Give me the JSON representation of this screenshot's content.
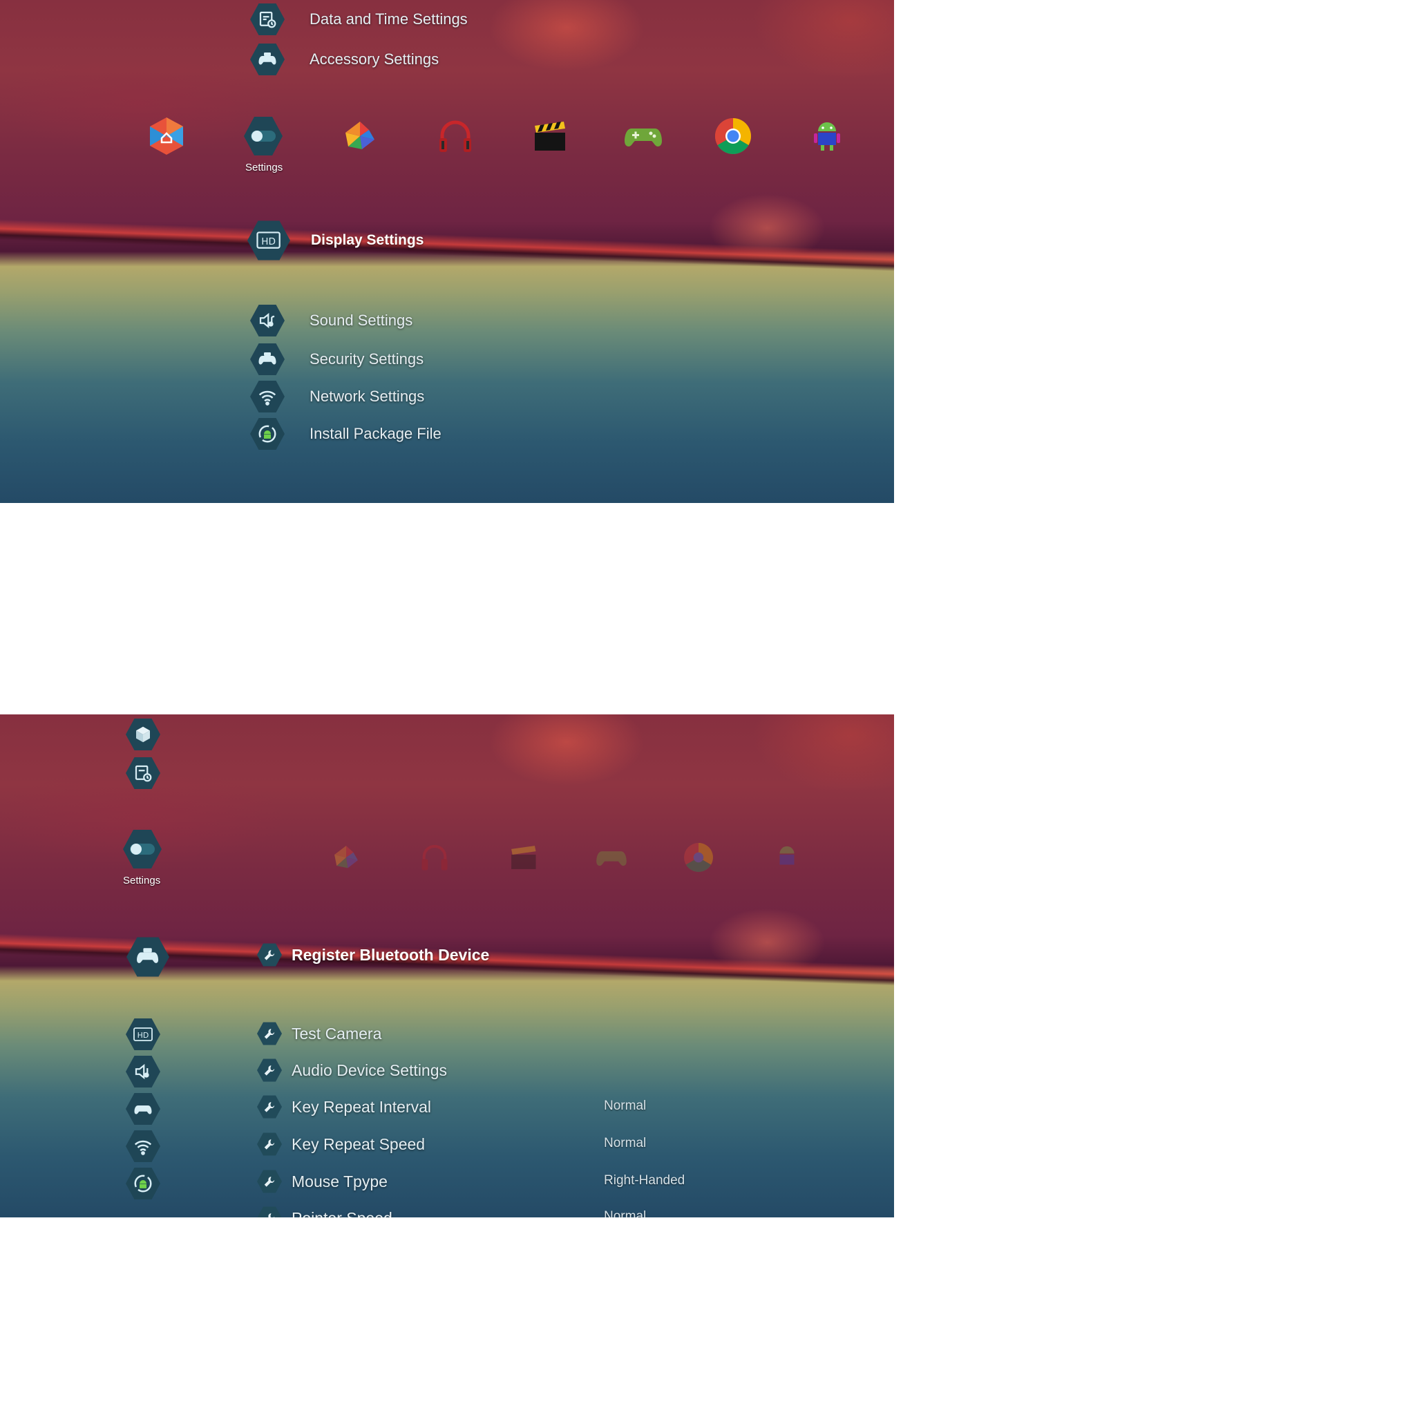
{
  "top": {
    "menu_items": [
      {
        "icon": "calendar-clock-icon",
        "label": "Data and Time Settings"
      },
      {
        "icon": "gamepad-icon",
        "label": "Accessory Settings"
      },
      {
        "icon": "hd-display-icon",
        "label": "Display Settings",
        "selected": true
      },
      {
        "icon": "speaker-icon",
        "label": "Sound Settings"
      },
      {
        "icon": "gamepad-icon",
        "label": "Security Settings"
      },
      {
        "icon": "wifi-icon",
        "label": "Network Settings"
      },
      {
        "icon": "android-refresh-icon",
        "label": "Install Package File"
      }
    ],
    "apps": [
      {
        "icon": "home-hex-icon"
      },
      {
        "icon": "settings-toggle-icon",
        "caption": "Settings"
      },
      {
        "icon": "photos-pinwheel-icon"
      },
      {
        "icon": "headphones-icon"
      },
      {
        "icon": "clapperboard-icon"
      },
      {
        "icon": "games-controller-icon"
      },
      {
        "icon": "chrome-icon"
      },
      {
        "icon": "android-robot-icon"
      }
    ]
  },
  "bottom": {
    "settings_caption": "Settings",
    "side_icons": [
      "cube-icon",
      "calendar-clock-icon",
      "gamepad-icon",
      "hd-display-icon",
      "speaker-icon",
      "gamepad-icon",
      "wifi-icon",
      "android-refresh-icon"
    ],
    "sub_items": [
      {
        "label": "Register Bluetooth Device",
        "value": "",
        "selected": true
      },
      {
        "label": "Test Camera",
        "value": ""
      },
      {
        "label": "Audio Device Settings",
        "value": ""
      },
      {
        "label": "Key Repeat Interval",
        "value": "Normal"
      },
      {
        "label": "Key Repeat Speed",
        "value": "Normal"
      },
      {
        "label": "Mouse Tpype",
        "value": "Right-Handed"
      },
      {
        "label": "Pointer Speed",
        "value": "Normal"
      }
    ]
  },
  "colors": {
    "icon_hex_bg": "#1f4656",
    "text": "#e6eef2",
    "selected_text": "#ffffff"
  }
}
